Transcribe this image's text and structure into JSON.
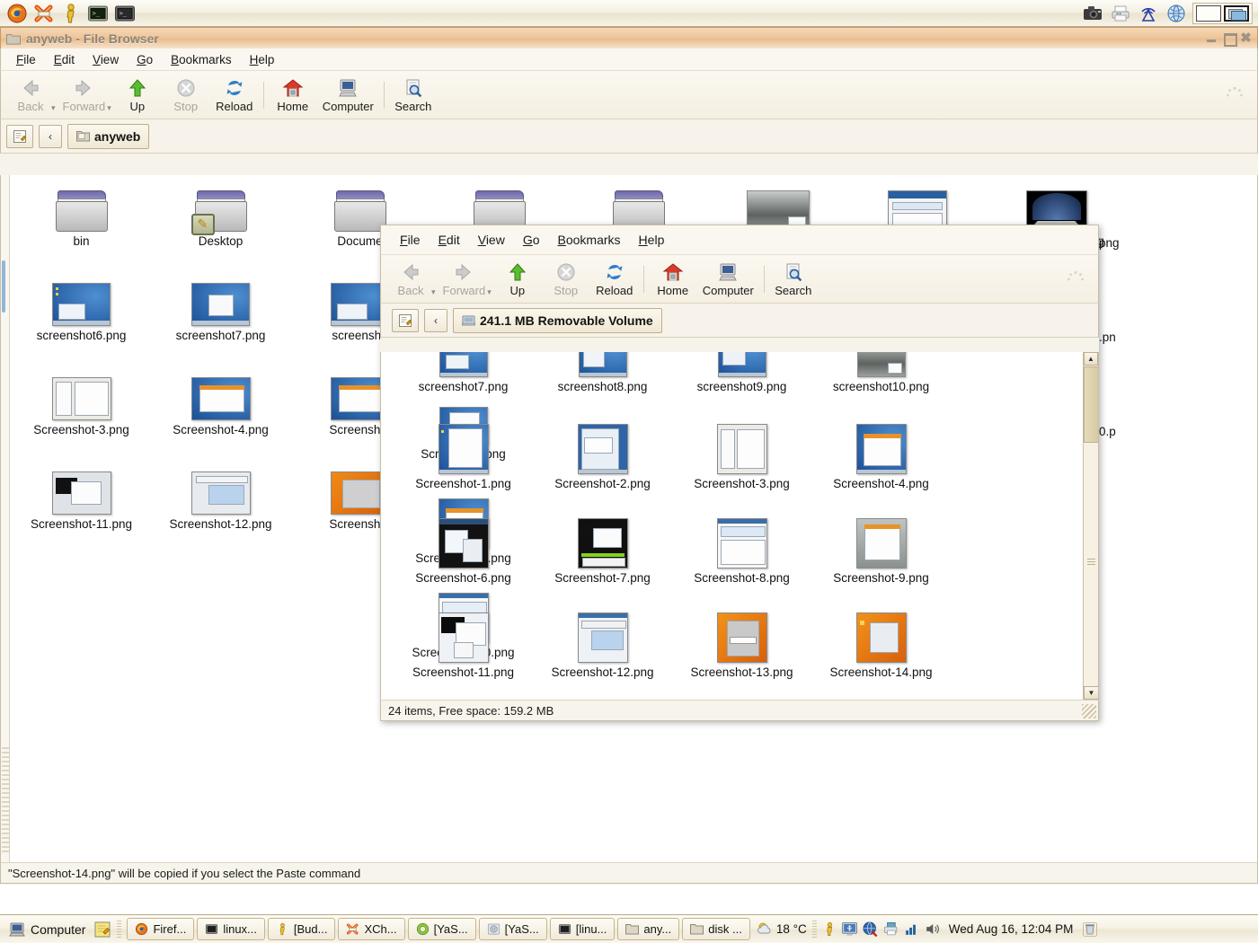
{
  "top_panel": {
    "launchers": [
      {
        "name": "firefox-icon",
        "title": "Firefox"
      },
      {
        "name": "xchat-icon",
        "title": "XChat"
      },
      {
        "name": "beagle-icon",
        "title": "Beagle Search"
      },
      {
        "name": "terminal-icon",
        "title": "Terminal"
      },
      {
        "name": "terminal2-icon",
        "title": "Terminal"
      }
    ],
    "tray": [
      {
        "name": "screenshot-icon",
        "title": "Take Screenshot"
      },
      {
        "name": "printer-icon",
        "title": "Printer"
      },
      {
        "name": "network-wireless-icon",
        "title": "Wireless Network"
      },
      {
        "name": "network-globe-icon",
        "title": "Network"
      }
    ],
    "workspaces": {
      "count": 2,
      "active": 2
    }
  },
  "back_window": {
    "title": "anyweb - File Browser",
    "menu": [
      "File",
      "Edit",
      "View",
      "Go",
      "Bookmarks",
      "Help"
    ],
    "toolbar": [
      {
        "label": "Back",
        "icon": "back-arrow-icon",
        "disabled": true
      },
      {
        "label": "Forward",
        "icon": "forward-arrow-icon",
        "disabled": true
      },
      {
        "label": "Up",
        "icon": "up-arrow-icon",
        "disabled": false
      },
      {
        "label": "Stop",
        "icon": "stop-icon",
        "disabled": true
      },
      {
        "label": "Reload",
        "icon": "reload-icon",
        "disabled": false
      },
      {
        "label": "Home",
        "icon": "home-icon",
        "disabled": false
      },
      {
        "label": "Computer",
        "icon": "computer-icon",
        "disabled": false
      },
      {
        "label": "Search",
        "icon": "search-icon",
        "disabled": false
      }
    ],
    "path_button_icon": "edit-location-icon",
    "path_back_icon": "chevron-left-icon",
    "location": "anyweb",
    "items": [
      {
        "name": "bin",
        "type": "folder"
      },
      {
        "name": "Desktop",
        "type": "folder",
        "emblem": "symbolic-link-emblem"
      },
      {
        "name": "Documents",
        "type": "folder",
        "truncated": "Docume"
      },
      {
        "name": "",
        "type": "folder"
      },
      {
        "name": "",
        "type": "folder"
      },
      {
        "name": "",
        "type": "image-cloud"
      },
      {
        "name": "",
        "type": "image-window"
      },
      {
        "name": "png",
        "type": "image-dark"
      },
      {
        "name": "screenshot6.png",
        "type": "image-desktop"
      },
      {
        "name": "screenshot7.png",
        "type": "image-desktop"
      },
      {
        "name": "screensho",
        "type": "image-desktop"
      },
      {
        "name": ".pn",
        "type": "image-desktop"
      },
      {
        "name": "Screenshot-3.png",
        "type": "image-light"
      },
      {
        "name": "Screenshot-4.png",
        "type": "image-desktop"
      },
      {
        "name": "Screenshot",
        "type": "image-desktop"
      },
      {
        "name": "0.p",
        "type": "image-desktop"
      },
      {
        "name": "Screenshot-11.png",
        "type": "image-black"
      },
      {
        "name": "Screenshot-12.png",
        "type": "image-spreadsheet"
      },
      {
        "name": "Screenshot",
        "type": "image-orange"
      }
    ]
  },
  "front_window": {
    "menu": [
      "File",
      "Edit",
      "View",
      "Go",
      "Bookmarks",
      "Help"
    ],
    "toolbar": [
      {
        "label": "Back",
        "icon": "back-arrow-icon",
        "disabled": true
      },
      {
        "label": "Forward",
        "icon": "forward-arrow-icon",
        "disabled": true
      },
      {
        "label": "Up",
        "icon": "up-arrow-icon",
        "disabled": false
      },
      {
        "label": "Stop",
        "icon": "stop-icon",
        "disabled": true
      },
      {
        "label": "Reload",
        "icon": "reload-icon",
        "disabled": false
      },
      {
        "label": "Home",
        "icon": "home-icon",
        "disabled": false
      },
      {
        "label": "Computer",
        "icon": "computer-icon",
        "disabled": false
      },
      {
        "label": "Search",
        "icon": "search-icon",
        "disabled": false
      }
    ],
    "location": "241.1 MB Removable Volume",
    "location_icon": "removable-volume-icon",
    "rows": [
      [
        {
          "name": "screenshot7.png",
          "type": "image-desktop"
        },
        {
          "name": "screenshot8.png",
          "type": "image-desktop"
        },
        {
          "name": "screenshot9.png",
          "type": "image-desktop"
        },
        {
          "name": "screenshot10.png",
          "type": "image-cloud"
        },
        {
          "name": "Screenshot.png",
          "type": "image-desktop"
        }
      ],
      [
        {
          "name": "Screenshot-1.png",
          "type": "image-doc"
        },
        {
          "name": "Screenshot-2.png",
          "type": "image-browser"
        },
        {
          "name": "Screenshot-3.png",
          "type": "image-light"
        },
        {
          "name": "Screenshot-4.png",
          "type": "image-desktop"
        },
        {
          "name": "Screenshot-5.png",
          "type": "image-desktop"
        }
      ],
      [
        {
          "name": "Screenshot-6.png",
          "type": "image-black"
        },
        {
          "name": "Screenshot-7.png",
          "type": "image-black2"
        },
        {
          "name": "Screenshot-8.png",
          "type": "image-light"
        },
        {
          "name": "Screenshot-9.png",
          "type": "image-light2"
        },
        {
          "name": "Screenshot-10.png",
          "type": "image-light"
        }
      ],
      [
        {
          "name": "Screenshot-11.png",
          "type": "image-black"
        },
        {
          "name": "Screenshot-12.png",
          "type": "image-spreadsheet"
        },
        {
          "name": "Screenshot-13.png",
          "type": "image-orange"
        },
        {
          "name": "Screenshot-14.png",
          "type": "image-orange2"
        }
      ]
    ],
    "status": "24 items, Free space: 159.2 MB"
  },
  "desktop_status": "\"Screenshot-14.png\" will be copied if you select the Paste command",
  "bottom_panel": {
    "show_desktop_label": "Computer",
    "notes_icon": "notes-icon",
    "tasks": [
      {
        "label": "Firef...",
        "icon": "firefox-icon"
      },
      {
        "label": "linux...",
        "icon": "terminal-icon"
      },
      {
        "label": "[Bud...",
        "icon": "beagle-icon"
      },
      {
        "label": "XCh...",
        "icon": "xchat-icon"
      },
      {
        "label": "[YaS...",
        "icon": "yast-icon"
      },
      {
        "label": "[YaS...",
        "icon": "yast-disc-icon"
      },
      {
        "label": "[linu...",
        "icon": "terminal-icon"
      },
      {
        "label": "any...",
        "icon": "folder-icon"
      },
      {
        "label": "disk ...",
        "icon": "folder-icon"
      }
    ],
    "weather": "18 °C",
    "weather_icon": "weather-sun-cloud-icon",
    "tray": [
      {
        "name": "beagle-icon"
      },
      {
        "name": "display-icon"
      },
      {
        "name": "network-globe-icon"
      },
      {
        "name": "printer-icon"
      },
      {
        "name": "signal-icon"
      },
      {
        "name": "volume-icon"
      }
    ],
    "clock": "Wed Aug 16, 12:04 PM",
    "trash_icon": "trash-icon"
  },
  "colors": {
    "panel_bg": "#f5f1e4",
    "titlebar_active": "#eec79c",
    "accent_border": "#c7b58f",
    "view_bg": "#ffffff"
  }
}
